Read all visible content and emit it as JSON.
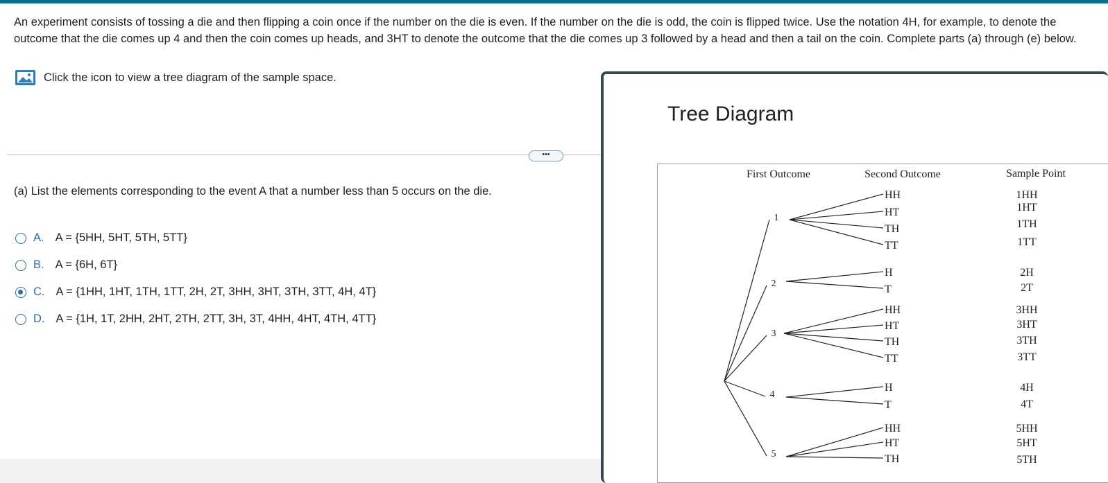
{
  "problem": {
    "text": "An experiment consists of tossing a die and then flipping a coin once if the number on the die is even. If the number on the die is odd, the coin is flipped twice. Use the notation 4H, for example, to denote the outcome that the die comes up 4 and then the coin comes up heads, and 3HT to denote the outcome that the die comes up 3 followed by a head and then a tail on the coin. Complete parts (a) through (e) below."
  },
  "view_link": {
    "label": "Click the icon to view a tree diagram of the sample space.",
    "icon": "image-icon"
  },
  "more_button": {
    "label": "•••"
  },
  "question": {
    "text": "(a) List the elements corresponding to the event A that a number less than 5 occurs on the die."
  },
  "options": [
    {
      "letter": "A.",
      "text": "A = {5HH, 5HT, 5TH, 5TT}",
      "selected": false
    },
    {
      "letter": "B.",
      "text": "A = {6H, 6T}",
      "selected": false
    },
    {
      "letter": "C.",
      "text": "A = {1HH, 1HT, 1TH, 1TT, 2H, 2T, 3HH, 3HT, 3TH, 3TT, 4H, 4T}",
      "selected": true
    },
    {
      "letter": "D.",
      "text": "A = {1H, 1T, 2HH, 2HT, 2TH, 2TT, 3H, 3T, 4HH, 4HT, 4TH, 4TT}",
      "selected": false
    }
  ],
  "popup": {
    "title": "Tree Diagram",
    "headers": {
      "first": "First Outcome",
      "second": "Second Outcome",
      "sample": "Sample Point"
    },
    "groups": [
      {
        "die": "1",
        "second": [
          "HH",
          "HT",
          "TH",
          "TT"
        ],
        "sample": [
          "1HH",
          "1HT",
          "1TH",
          "1TT"
        ]
      },
      {
        "die": "2",
        "second": [
          "H",
          "T"
        ],
        "sample": [
          "2H",
          "2T"
        ]
      },
      {
        "die": "3",
        "second": [
          "HH",
          "HT",
          "TH",
          "TT"
        ],
        "sample": [
          "3HH",
          "3HT",
          "3TH",
          "3TT"
        ]
      },
      {
        "die": "4",
        "second": [
          "H",
          "T"
        ],
        "sample": [
          "4H",
          "4T"
        ]
      },
      {
        "die": "5",
        "second": [
          "HH",
          "HT",
          "TH"
        ],
        "sample": [
          "5HH",
          "5HT",
          "5TH"
        ]
      }
    ]
  },
  "colors": {
    "accent": "#00718f",
    "link_blue": "#2a6db0",
    "frame": "#37474f"
  }
}
